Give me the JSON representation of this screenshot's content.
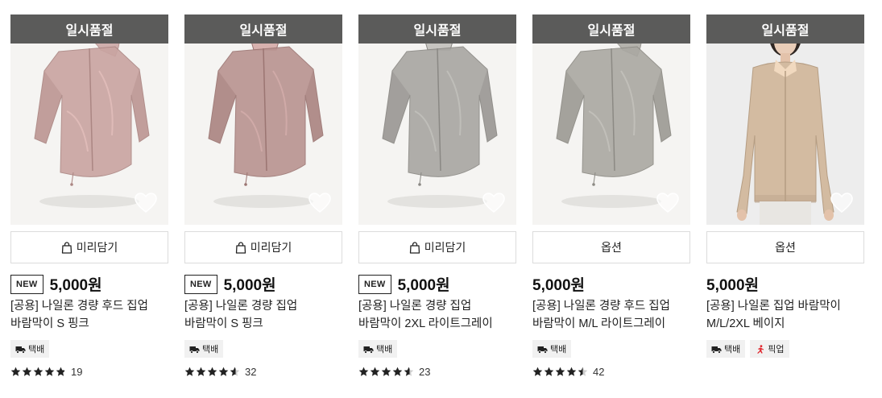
{
  "products": [
    {
      "soldout_label": "일시품절",
      "button_label": "미리담기",
      "button_has_bag_icon": true,
      "new_label": "NEW",
      "price": "5,000원",
      "title_line1": "[공용] 나일론 경량 후드 집업",
      "title_line2": "바람막이 S 핑크",
      "tags": [
        {
          "icon": "truck-icon",
          "label": "택배"
        }
      ],
      "rating": 4.9,
      "review_count": "19",
      "image": {
        "kind": "hood-jacket",
        "color": "#c9a4a1"
      }
    },
    {
      "soldout_label": "일시품절",
      "button_label": "미리담기",
      "button_has_bag_icon": true,
      "new_label": "NEW",
      "price": "5,000원",
      "title_line1": "[공용] 나일론 경량 집업",
      "title_line2": "바람막이 S 핑크",
      "tags": [
        {
          "icon": "truck-icon",
          "label": "택배"
        }
      ],
      "rating": 4.6,
      "review_count": "32",
      "image": {
        "kind": "zip-jacket",
        "color": "#b99390"
      }
    },
    {
      "soldout_label": "일시품절",
      "button_label": "미리담기",
      "button_has_bag_icon": true,
      "new_label": "NEW",
      "price": "5,000원",
      "title_line1": "[공용] 나일론 경량 집업",
      "title_line2": "바람막이 2XL 라이트그레이",
      "tags": [
        {
          "icon": "truck-icon",
          "label": "택배"
        }
      ],
      "rating": 4.6,
      "review_count": "23",
      "image": {
        "kind": "zip-jacket",
        "color": "#a8a6a2"
      }
    },
    {
      "soldout_label": "일시품절",
      "button_label": "옵션",
      "button_has_bag_icon": false,
      "new_label": "",
      "price": "5,000원",
      "title_line1": "[공용] 나일론 경량 후드 집업",
      "title_line2": "바람막이 M/L 라이트그레이",
      "tags": [
        {
          "icon": "truck-icon",
          "label": "택배"
        }
      ],
      "rating": 4.5,
      "review_count": "42",
      "image": {
        "kind": "hood-jacket",
        "color": "#aaa8a2"
      }
    },
    {
      "soldout_label": "일시품절",
      "button_label": "옵션",
      "button_has_bag_icon": false,
      "new_label": "",
      "price": "5,000원",
      "title_line1": "[공용] 나일론 집업 바람막이",
      "title_line2": "M/L/2XL 베이지",
      "tags": [
        {
          "icon": "truck-icon",
          "label": "택배"
        },
        {
          "icon": "pickup-runner-icon",
          "label": "픽업"
        }
      ],
      "rating": null,
      "review_count": "",
      "image": {
        "kind": "model-beige",
        "color": "#d3bba1"
      }
    }
  ],
  "colors": {
    "soldout_bg": "#5b5b5a",
    "star": "#222222",
    "pickup_red": "#e0242b"
  }
}
